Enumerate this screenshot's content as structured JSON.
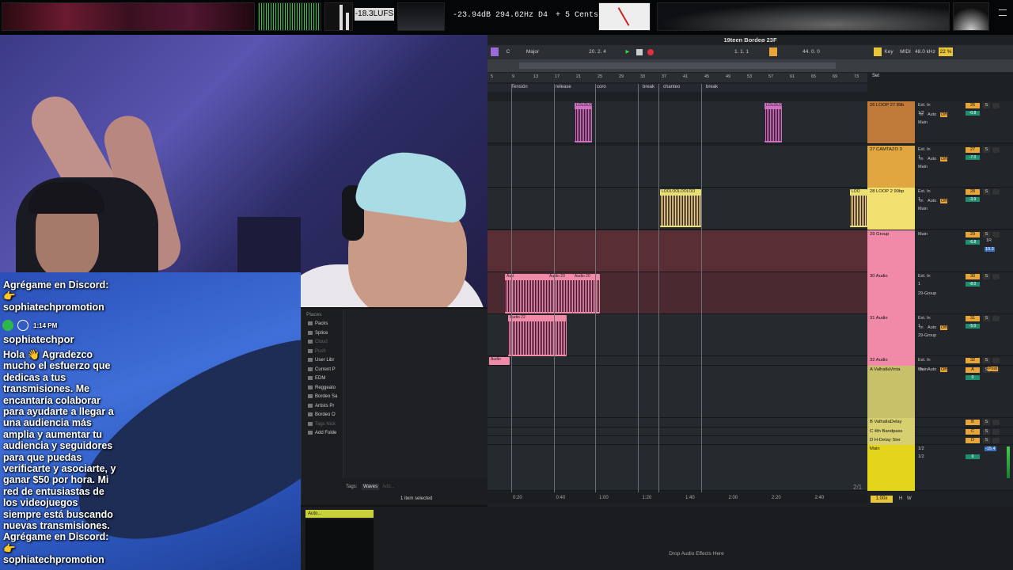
{
  "topbar": {
    "lufs": "-18.3LUFS",
    "level_db": "-23.94dB",
    "freq": "294.62Hz",
    "note": "D4",
    "cents": "+ 5 Cents"
  },
  "chat": {
    "prev_line1": "Agrégame en Discord:",
    "prev_line2": "👉",
    "prev_line3": "sophiatechpromotion",
    "time": "1:14 PM",
    "username": "sophiatechpor",
    "message_lines": [
      "Hola 👋 Agradezco",
      "mucho el esfuerzo que",
      "dedicas a tus",
      "transmisiones. Me",
      "encantaría colaborar",
      "para ayudarte a llegar a",
      "una audiencia más",
      "amplia y aumentar tu",
      "audiencia y seguidores",
      "para que puedas",
      "verificarte y asociarte, y",
      "ganar $50 por hora. Mi",
      "red de entusiastas de",
      "los videojuegos",
      "siempre está buscando",
      "nuevas transmisiones.",
      "Agrégame en Discord:",
      "👉",
      "sophiatechpromotion"
    ]
  },
  "browser": {
    "places_label": "Places",
    "items": [
      "Packs",
      "Splice",
      "Cloud",
      "Push",
      "User Libr",
      "Current P",
      "EDM",
      "Reggeato",
      "Bordeo Sa",
      "Artists Pr",
      "Bordeo O",
      "Tags Nick",
      "Add Folde"
    ],
    "tags_label": "Tags:",
    "tag_waves": "Waves",
    "tag_add": "Add...",
    "status": "1 item selected"
  },
  "daw": {
    "project_title": "19teen Bordeø 23F",
    "key": "C",
    "scale": "Major",
    "bar_pos": "20.  2.  4",
    "loop_pos": "1.  1.  1",
    "loop_len": "44.  0.  0",
    "key_label": "Key",
    "midi_label": "MIDI",
    "sample_rate": "48.0 kHz",
    "cpu": "22 %",
    "ruler_marks": [
      "5",
      "9",
      "13",
      "17",
      "21",
      "25",
      "29",
      "33",
      "37",
      "41",
      "45",
      "49",
      "53",
      "57",
      "61",
      "65",
      "69",
      "73"
    ],
    "set_label": "Set",
    "locators": [
      "Tensión",
      "release",
      "coro",
      "break",
      "chanteo",
      "break"
    ],
    "tracks": [
      {
        "name": "26 LOOP 27 89b",
        "num": "26",
        "input": "Ext. In",
        "ch": "1/2",
        "out": "Main",
        "vol": "-0.8"
      },
      {
        "name": "27 CAMTAZO 3",
        "num": "27",
        "input": "Ext. In",
        "ch": "1",
        "out": "Main",
        "vol": "-7.0"
      },
      {
        "name": "28 LOOP 2 90bp",
        "num": "28",
        "input": "Ext. In",
        "ch": "1",
        "out": "Main",
        "vol": "-3.9"
      },
      {
        "name": "29 Group",
        "num": "29",
        "input": "Main",
        "ch": "",
        "out": "",
        "vol": "-6.8"
      },
      {
        "name": "30 Audio",
        "num": "30",
        "input": "Ext. In",
        "ch": "1",
        "out": "29-Group",
        "vol": "-8.0"
      },
      {
        "name": "31 Audio",
        "num": "31",
        "input": "Ext. In",
        "ch": "1",
        "out": "29-Group",
        "vol": "-5.0"
      },
      {
        "name": "32 Audio",
        "num": "32",
        "input": "Ext. In",
        "ch": "",
        "out": "",
        "vol": ""
      },
      {
        "name": "A ValhallaVinta",
        "num": "A",
        "input": "Main",
        "ch": "",
        "out": "",
        "vol": "0"
      },
      {
        "name": "B ValhallaDelay",
        "num": "B",
        "input": "",
        "ch": "",
        "out": "",
        "vol": ""
      },
      {
        "name": "C 4th Bandpass",
        "num": "C",
        "input": "",
        "ch": "",
        "out": "",
        "vol": ""
      },
      {
        "name": "D H-Delay Ster",
        "num": "D",
        "input": "",
        "ch": "",
        "out": "",
        "vol": ""
      },
      {
        "name": "Main",
        "num": "",
        "input": "1/2",
        "ch": "1/2",
        "out": "",
        "vol": "0"
      }
    ],
    "pan_value": "10.3",
    "pan_right": "1R",
    "main_vol": "-15.4",
    "clip_labels": [
      "LOLOLOI",
      "LOOLOOLOOLOO",
      "LOO",
      "Audio 20",
      "Audio 20",
      "Aud",
      "Audio 22",
      "Audio"
    ],
    "times": [
      "0:20",
      "0:40",
      "1:00",
      "1:20",
      "1:40",
      "2:00",
      "2:20",
      "2:40"
    ],
    "page": "2/1",
    "zoom": "1.00x",
    "io": [
      "H",
      "W"
    ],
    "auto": "Auto",
    "off": "Off",
    "in": "In",
    "post": "Post"
  },
  "bottom": {
    "device_label": "Auto...",
    "drop_hint": "Drop Audio Effects Here"
  }
}
